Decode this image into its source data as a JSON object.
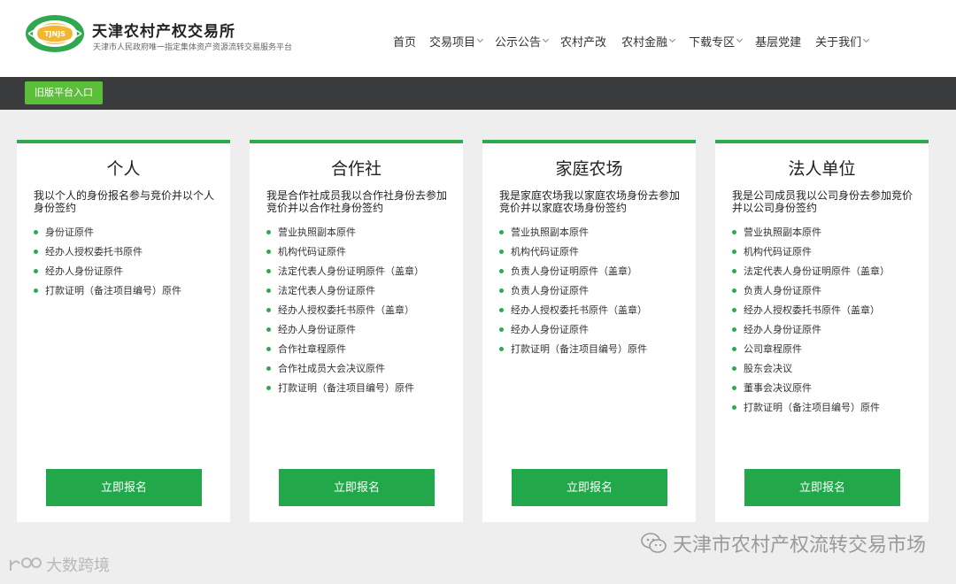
{
  "header": {
    "logo_text": "TJNJS",
    "title": "天津农村产权交易所",
    "subtitle": "天津市人民政府唯一指定集体资产资源流转交易服务平台"
  },
  "nav": [
    {
      "label": "首页",
      "has_dropdown": false
    },
    {
      "label": "交易项目",
      "has_dropdown": true
    },
    {
      "label": "公示公告",
      "has_dropdown": true
    },
    {
      "label": "农村产改",
      "has_dropdown": false
    },
    {
      "label": "农村金融",
      "has_dropdown": true
    },
    {
      "label": "下载专区",
      "has_dropdown": true
    },
    {
      "label": "基层党建",
      "has_dropdown": false
    },
    {
      "label": "关于我们",
      "has_dropdown": true
    }
  ],
  "old_platform_label": "旧版平台入口",
  "cards": [
    {
      "title": "个人",
      "desc": "我以个人的身份报名参与竞价并以个人身份签约",
      "items": [
        "身份证原件",
        "经办人授权委托书原件",
        "经办人身份证原件",
        "打款证明（备注项目编号）原件"
      ],
      "button": "立即报名"
    },
    {
      "title": "合作社",
      "desc": "我是合作社成员我以合作社身份去参加竞价并以合作社身份签约",
      "items": [
        "营业执照副本原件",
        "机构代码证原件",
        "法定代表人身份证明原件（盖章）",
        "法定代表人身份证原件",
        "经办人授权委托书原件（盖章）",
        "经办人身份证原件",
        "合作社章程原件",
        "合作社成员大会决议原件",
        "打款证明（备注项目编号）原件"
      ],
      "button": "立即报名"
    },
    {
      "title": "家庭农场",
      "desc": "我是家庭农场我以家庭农场身份去参加竞价并以家庭农场身份签约",
      "items": [
        "营业执照副本原件",
        "机构代码证原件",
        "负责人身份证明原件（盖章）",
        "负责人身份证原件",
        "经办人授权委托书原件（盖章）",
        "经办人身份证原件",
        "打款证明（备注项目编号）原件"
      ],
      "button": "立即报名"
    },
    {
      "title": "法人单位",
      "desc": "我是公司成员我以公司身份去参加竞价并以公司身份签约",
      "items": [
        "营业执照副本原件",
        "机构代码证原件",
        "法定代表人身份证明原件（盖章）",
        "负责人身份证原件",
        "经办人授权委托书原件（盖章）",
        "经办人身份证原件",
        "公司章程原件",
        "股东会决议",
        "董事会决议原件",
        "打款证明（备注项目编号）原件"
      ],
      "button": "立即报名"
    }
  ],
  "watermark_right": "天津市农村产权流转交易市场",
  "watermark_left": "大数跨境",
  "colors": {
    "accent_green": "#2fa84f",
    "button_green": "#22a84a",
    "old_platform_green": "#5cbf3a",
    "dark_bar": "#3a3b3c",
    "page_bg": "#eeeeee"
  }
}
